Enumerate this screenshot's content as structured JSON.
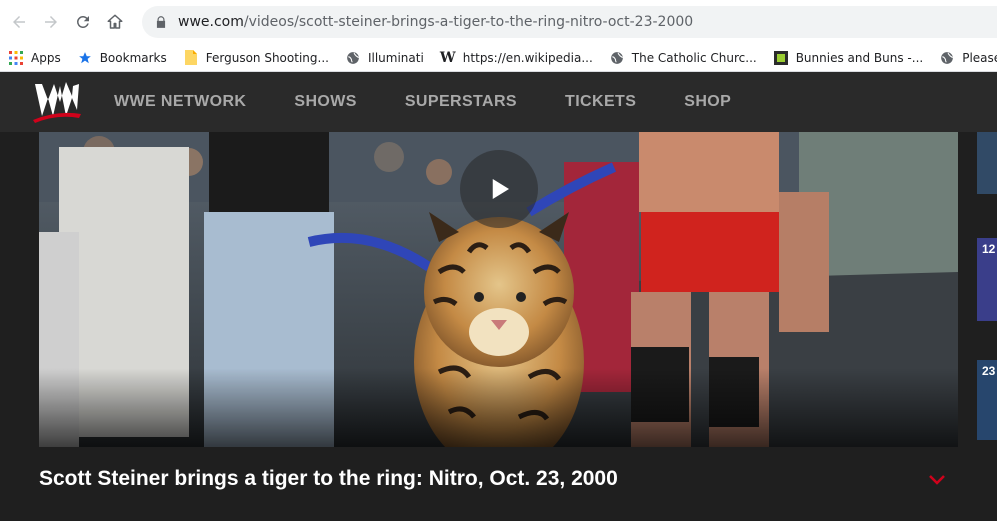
{
  "browser": {
    "url_host": "wwe.com",
    "url_path": "/videos/scott-steiner-brings-a-tiger-to-the-ring-nitro-oct-23-2000",
    "bookmarks": [
      {
        "label": "Apps",
        "icon": "apps-grid-icon"
      },
      {
        "label": "Bookmarks",
        "icon": "star-icon"
      },
      {
        "label": "Ferguson Shooting...",
        "icon": "folder-icon"
      },
      {
        "label": "Illuminati",
        "icon": "globe-icon"
      },
      {
        "label": "https://en.wikipedia...",
        "icon": "wikipedia-icon"
      },
      {
        "label": "The Catholic Churc...",
        "icon": "globe-icon"
      },
      {
        "label": "Bunnies and Buns -...",
        "icon": "site-favicon-icon"
      },
      {
        "label": "Pleasenoguitar.mp",
        "icon": "globe-icon"
      }
    ]
  },
  "site": {
    "nav": [
      "WWE NETWORK",
      "SHOWS",
      "SUPERSTARS",
      "TICKETS",
      "SHOP"
    ]
  },
  "video": {
    "title": "Scott Steiner brings a tiger to the ring: Nitro, Oct. 23, 2000"
  },
  "sidebar": {
    "thumbs": [
      {
        "num": ""
      },
      {
        "num": "12"
      },
      {
        "num": "23"
      }
    ]
  },
  "colors": {
    "accent_red": "#d0021b",
    "nav_bg": "#2a2a2a",
    "page_bg": "#1f1f1f"
  }
}
